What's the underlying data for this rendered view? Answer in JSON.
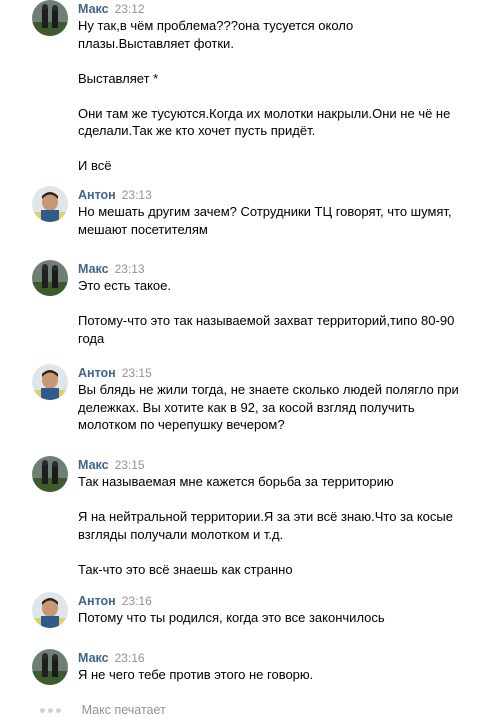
{
  "messages": [
    {
      "author": "Макс",
      "time": "23:12",
      "avatar": "maks-avatar",
      "paragraphs": [
        "Ну так,в чём проблема???она тусуется около\nплазы.Выставляет фотки.",
        "Выставляет *",
        "Они там же тусуются.Когда их молотки накрыли.Они не чё не\nсделали.Так же кто хочет пусть придёт.",
        "И всё"
      ]
    },
    {
      "author": "Антон",
      "time": "23:13",
      "avatar": "anton-avatar",
      "paragraphs": [
        "Но мешать другим зачем? Сотрудники ТЦ говорят, что шумят,\nмешают посетителям"
      ]
    },
    {
      "author": "Макс",
      "time": "23:13",
      "avatar": "maks-avatar",
      "paragraphs": [
        "Это есть такое.",
        "Потому-что это так называемой захват территорий,типо 80-90\nгода"
      ]
    },
    {
      "author": "Антон",
      "time": "23:15",
      "avatar": "anton-avatar",
      "paragraphs": [
        "Вы блядь не жили тогда, не знаете сколько людей полягло при\nдележках. Вы хотите как в 92, за косой взгляд получить\nмолотком по черепушку вечером?"
      ]
    },
    {
      "author": "Макс",
      "time": "23:15",
      "avatar": "maks-avatar",
      "paragraphs": [
        "Так называемая мне кажется борьба за территорию",
        "Я на нейтральной территории.Я за эти всё знаю.Что за косые\nвзгляды получали молотком и т.д.",
        "Так-что это всё знаешь как странно"
      ]
    },
    {
      "author": "Антон",
      "time": "23:16",
      "avatar": "anton-avatar",
      "paragraphs": [
        "Потому что ты родился, когда это все закончилось"
      ]
    },
    {
      "author": "Макс",
      "time": "23:16",
      "avatar": "maks-avatar",
      "paragraphs": [
        "Я не чего тебе против этого не говорю."
      ]
    }
  ],
  "typing_indicator": "Макс печатает",
  "colors": {
    "author": "#42648b",
    "time": "#939393",
    "text": "#000000",
    "typing_dots": "#c9d3de"
  }
}
